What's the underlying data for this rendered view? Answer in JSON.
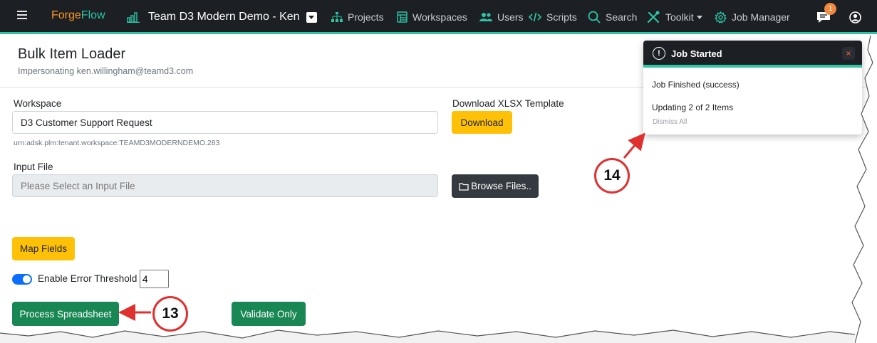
{
  "navbar": {
    "brand_part1": "Forge",
    "brand_part2": "Flow",
    "team_name": "Team D3 Modern Demo - Ken",
    "links": {
      "projects": "Projects",
      "workspaces": "Workspaces",
      "users": "Users",
      "scripts": "Scripts",
      "search": "Search",
      "toolkit": "Toolkit",
      "job_manager": "Job Manager"
    },
    "notification_count": "1",
    "icons": [
      "menu-icon",
      "chart-icon",
      "dropdown-icon",
      "sitemap-icon",
      "list-icon",
      "users-icon",
      "code-icon",
      "search-icon",
      "tools-icon",
      "gear-icon",
      "chat-icon",
      "user-icon"
    ]
  },
  "header": {
    "title": "Bulk Item Loader",
    "impersonating": "Impersonating ken.willingham@teamd3.com"
  },
  "form": {
    "workspace_label": "Workspace",
    "workspace_value": "D3 Customer Support Request",
    "workspace_urn": "urn:adsk.plm:tenant.workspace:TEAMD3MODERNDEMO.283",
    "template_label": "Download XLSX Template",
    "download_button": "Download",
    "input_file_label": "Input File",
    "input_file_placeholder": "Please Select an Input File",
    "browse_button": "Browse Files..",
    "map_fields_button": "Map Fields",
    "error_threshold_label": "Enable Error Threshold",
    "error_threshold_value": "4",
    "process_button": "Process Spreadsheet",
    "validate_button": "Validate Only"
  },
  "toast": {
    "title": "Job Started",
    "close": "×",
    "line1": "Job Finished (success)",
    "line2": "Updating 2 of 2 Items",
    "dismiss": "Dismiss All"
  },
  "callouts": {
    "process": "13",
    "toast": "14"
  },
  "colors": {
    "navbar_bg": "#1c1f24",
    "accent_teal": "#2ec4a4",
    "brand_orange": "#ff9a1f",
    "warning_yellow": "#ffc107",
    "success_green": "#198754",
    "callout_red": "#e03131"
  }
}
